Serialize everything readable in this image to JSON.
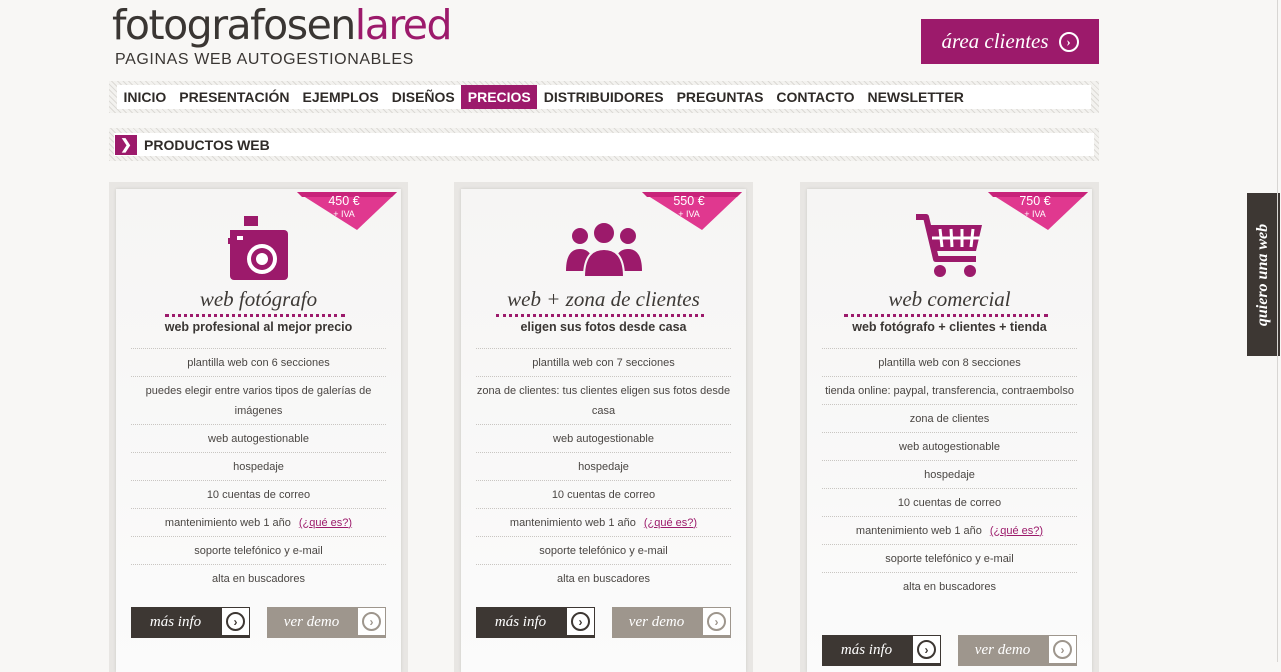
{
  "brand": {
    "logo_parts": [
      "fotografos",
      "en",
      "la",
      "red"
    ],
    "tagline": "PAGINAS WEB AUTOGESTIONABLES",
    "accent_color": "#9c1a6b"
  },
  "header": {
    "client_area_label": "área clientes",
    "client_area_icon": "chevron-right-circle-icon"
  },
  "nav": {
    "items": [
      {
        "label": "INICIO"
      },
      {
        "label": "PRESENTACIÓN"
      },
      {
        "label": "EJEMPLOS"
      },
      {
        "label": "DISEÑOS"
      },
      {
        "label": "PRECIOS",
        "active": true
      },
      {
        "label": "DISTRIBUIDORES"
      },
      {
        "label": "PREGUNTAS"
      },
      {
        "label": "CONTACTO"
      },
      {
        "label": "NEWSLETTER"
      }
    ]
  },
  "section": {
    "title": "PRODUCTOS WEB",
    "icon": "chevron-right-icon"
  },
  "side_tab": {
    "label": "quiero una web"
  },
  "products": [
    {
      "price": "450 €",
      "price_note": "+ IVA",
      "icon": "camera-icon",
      "title": "web fotógrafo",
      "subtitle": "web profesional al mejor precio",
      "features": [
        {
          "text": "plantilla web con 6 secciones"
        },
        {
          "text": "puedes elegir entre varios tipos de galerías de imágenes"
        },
        {
          "text": "web autogestionable"
        },
        {
          "text": "hospedaje"
        },
        {
          "text": "10 cuentas de correo"
        },
        {
          "text": "mantenimiento web 1 año",
          "link": "(¿qué es?)"
        },
        {
          "text": "soporte telefónico y e-mail"
        },
        {
          "text": "alta en buscadores"
        }
      ],
      "more_info_label": "más info",
      "demo_label": "ver demo"
    },
    {
      "price": "550 €",
      "price_note": "+ IVA",
      "icon": "people-group-icon",
      "title": "web + zona de clientes",
      "subtitle": "eligen sus fotos desde casa",
      "features": [
        {
          "text": "plantilla web con 7 secciones"
        },
        {
          "text": "zona de clientes: tus clientes eligen sus fotos desde casa"
        },
        {
          "text": "web autogestionable"
        },
        {
          "text": "hospedaje"
        },
        {
          "text": "10 cuentas de correo"
        },
        {
          "text": "mantenimiento web 1 año",
          "link": "(¿qué es?)"
        },
        {
          "text": "soporte telefónico y e-mail"
        },
        {
          "text": "alta en buscadores"
        }
      ],
      "more_info_label": "más info",
      "demo_label": "ver demo"
    },
    {
      "price": "750 €",
      "price_note": "+ IVA",
      "icon": "shopping-cart-icon",
      "title": "web comercial",
      "subtitle": "web fotógrafo + clientes + tienda",
      "features": [
        {
          "text": "plantilla web con 8 secciones"
        },
        {
          "text": "tienda online: paypal, transferencia, contraembolso"
        },
        {
          "text": "zona de clientes"
        },
        {
          "text": "web autogestionable"
        },
        {
          "text": "hospedaje"
        },
        {
          "text": "10 cuentas de correo"
        },
        {
          "text": "mantenimiento web 1 año",
          "link": "(¿qué es?)"
        },
        {
          "text": "soporte telefónico y e-mail"
        },
        {
          "text": "alta en buscadores"
        }
      ],
      "more_info_label": "más info",
      "demo_label": "ver demo"
    }
  ]
}
